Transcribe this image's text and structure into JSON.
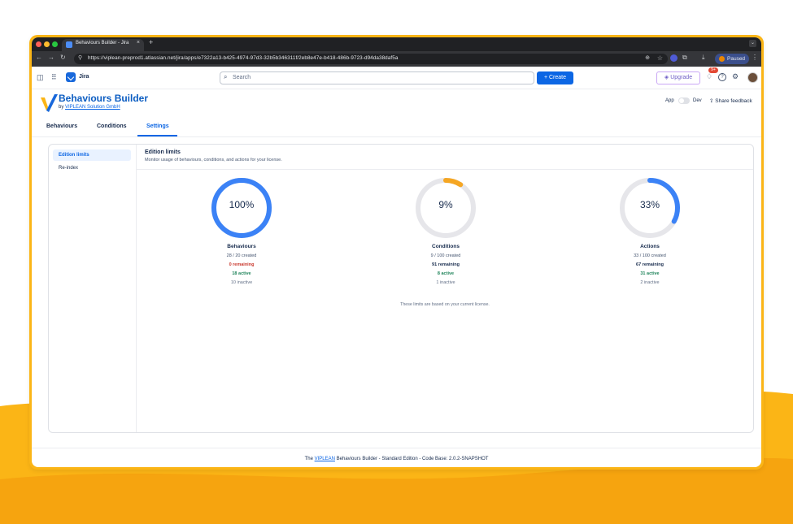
{
  "colors": {
    "frame_accent": "#fbb516",
    "jira_blue": "#0c66e4",
    "ring_blue": "#3b82f6",
    "ring_orange": "#f5a623",
    "ring_track": "#e6e6ea",
    "danger": "#c9372c",
    "success": "#1f845a"
  },
  "browser": {
    "tab_title": "Behaviours Builder - Jira",
    "tab_close": "×",
    "new_tab": "+",
    "url": "https://viplean-preprod1.atlassian.net/jira/apps/e7322a13-b425-4974-97d3-32b5b346311f/2eb8e47e-b418-486b-9723-d94da38daf5a",
    "profile_status": "Paused",
    "icons": [
      "back-icon",
      "forward-icon",
      "reload-icon",
      "tune-icon",
      "zoom-icon",
      "star-icon",
      "extension-icon",
      "puzzle-icon",
      "download-icon",
      "kebab-icon"
    ]
  },
  "topnav": {
    "product": "Jira",
    "search_placeholder": "Search",
    "create_label": "+ Create",
    "upgrade_label": "Upgrade",
    "notifications_badge": "9+"
  },
  "app": {
    "title": "Behaviours Builder",
    "by_prefix": "by",
    "company": "VIPLEAN Solution GmbH",
    "toggle_left": "App",
    "toggle_right": "Dev",
    "share_feedback": "Share feedback",
    "tabs": [
      {
        "label": "Behaviours",
        "active": false
      },
      {
        "label": "Conditions",
        "active": false
      },
      {
        "label": "Settings",
        "active": true
      }
    ]
  },
  "sidebar": {
    "items": [
      {
        "label": "Edition limits",
        "active": true
      },
      {
        "label": "Re-index",
        "active": false
      }
    ]
  },
  "edition_limits": {
    "title": "Edition limits",
    "subtitle": "Monitor usage of behaviours, conditions, and actions for your license.",
    "metrics": [
      {
        "name": "Behaviours",
        "percent_label": "100%",
        "percent": 100,
        "color": "#3b82f6",
        "created": "28 / 20 created",
        "remaining": "0 remaining",
        "remaining_style": "red",
        "active": "18 active",
        "inactive": "10 inactive"
      },
      {
        "name": "Conditions",
        "percent_label": "9%",
        "percent": 9,
        "color": "#f5a623",
        "created": "9 / 100 created",
        "remaining": "91 remaining",
        "remaining_style": "bold",
        "active": "8 active",
        "inactive": "1 inactive"
      },
      {
        "name": "Actions",
        "percent_label": "33%",
        "percent": 33,
        "color": "#3b82f6",
        "created": "33 / 100 created",
        "remaining": "67 remaining",
        "remaining_style": "bold",
        "active": "31 active",
        "inactive": "2 inactive"
      }
    ],
    "note": "These limits are based on your current license."
  },
  "footer": {
    "prefix": "The",
    "brand": "VIPLEAN",
    "suffix": "Behaviours Builder - Standard Edition - Code Base: 2.0.2-SNAPSHOT"
  }
}
